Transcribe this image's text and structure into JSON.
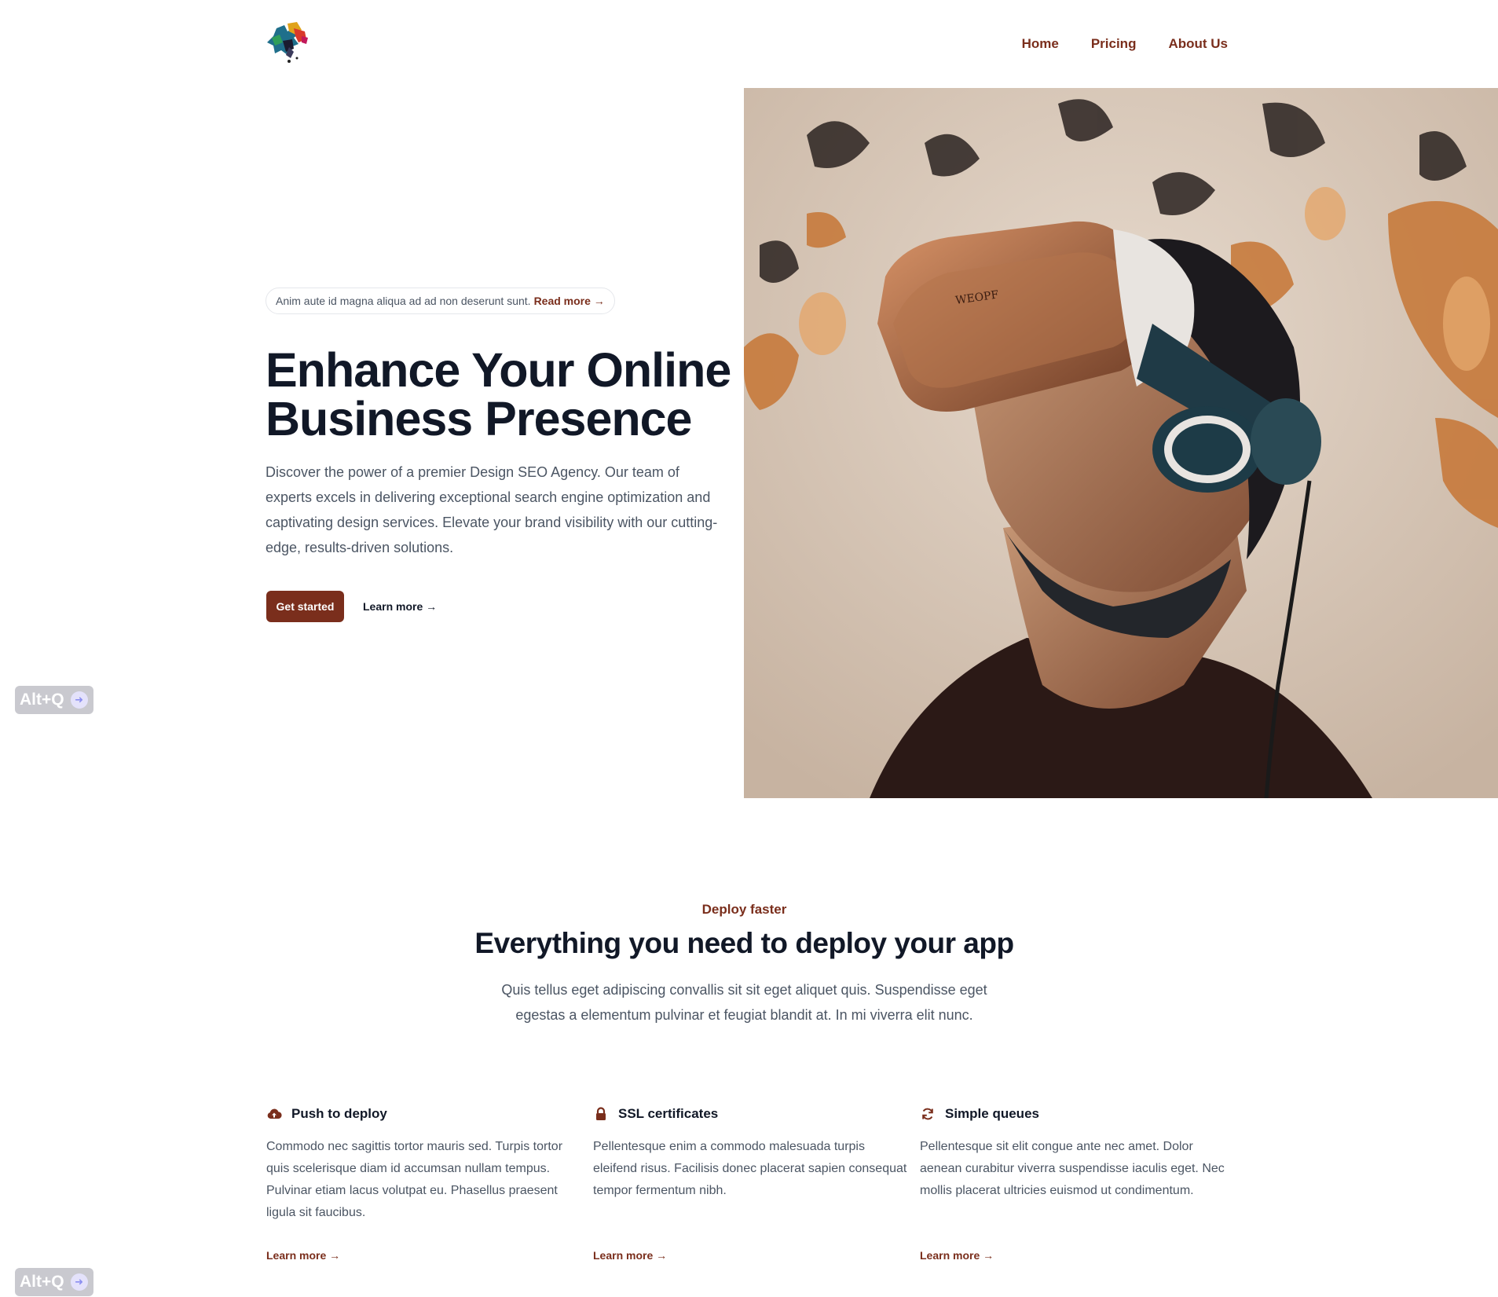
{
  "header": {
    "logo_icon": "puzzle-logo-icon",
    "nav": [
      "Home",
      "Pricing",
      "About Us"
    ]
  },
  "hero": {
    "announcement": "Anim aute id magna aliqua ad ad non deserunt sunt.",
    "announcement_link": "Read more →",
    "title": "Enhance Your Online Business Presence",
    "description": "Discover the power of a premier Design SEO Agency. Our team of experts excels in delivering exceptional search engine optimization and captivating design services. Elevate your brand visibility with our cutting-edge, results-driven solutions.",
    "primary_button": "Get started",
    "secondary_link": "Learn more →"
  },
  "features_section": {
    "eyebrow": "Deploy faster",
    "title": "Everything you need to deploy your app",
    "description": "Quis tellus eget adipiscing convallis sit sit eget aliquet quis. Suspendisse eget egestas a elementum pulvinar et feugiat blandit at. In mi viverra elit nunc.",
    "features": [
      {
        "icon": "cloud-upload-icon",
        "name": "Push to deploy",
        "description": "Commodo nec sagittis tortor mauris sed. Turpis tortor quis scelerisque diam id accumsan nullam tempus. Pulvinar etiam lacus volutpat eu. Phasellus praesent ligula sit faucibus.",
        "link": "Learn more →"
      },
      {
        "icon": "lock-icon",
        "name": "SSL certificates",
        "description": "Pellentesque enim a commodo malesuada turpis eleifend risus. Facilisis donec placerat sapien consequat tempor fermentum nibh.",
        "link": "Learn more →"
      },
      {
        "icon": "refresh-icon",
        "name": "Simple queues",
        "description": "Pellentesque sit elit congue ante nec amet. Dolor aenean curabitur viverra suspendisse iaculis eget. Nec mollis placerat ultricies euismod ut condimentum.",
        "link": "Learn more →"
      }
    ]
  },
  "overlay": {
    "shortcut_badge": "Alt+Q"
  },
  "colors": {
    "accent": "#7a2e1c",
    "heading": "#111827",
    "body_text": "#4b5563"
  }
}
